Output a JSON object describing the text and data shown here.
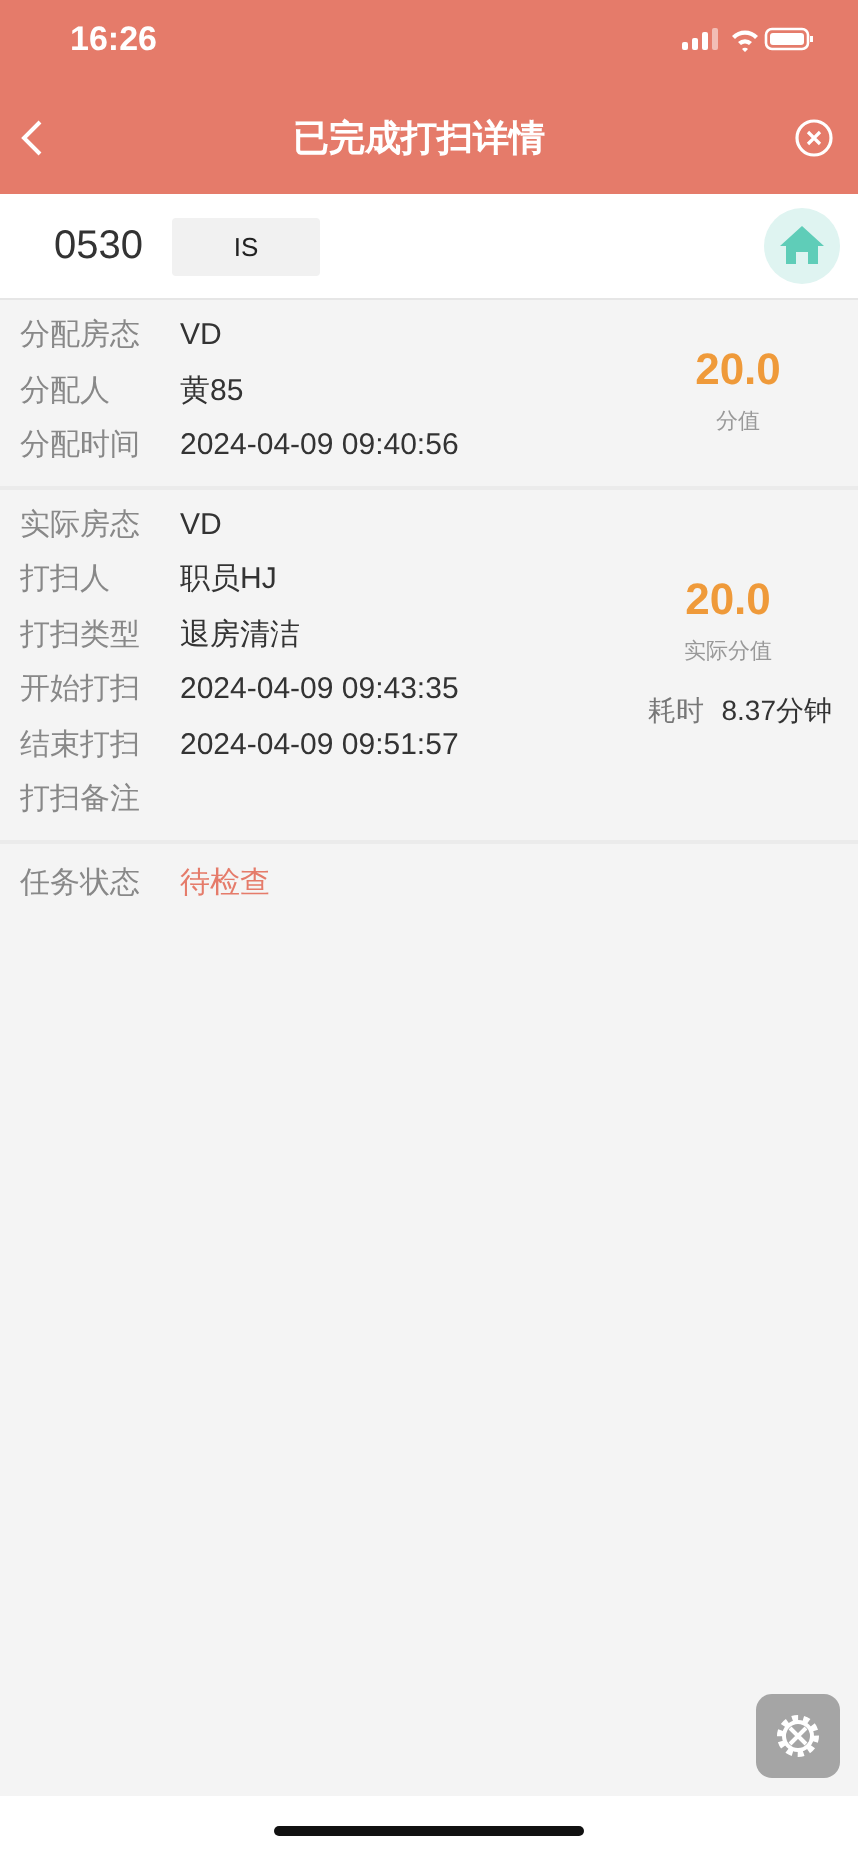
{
  "status_bar": {
    "time": "16:26"
  },
  "nav": {
    "title": "已完成打扫详情"
  },
  "room": {
    "number": "0530",
    "status": "IS"
  },
  "assigned": {
    "rows": [
      {
        "label": "分配房态",
        "value": "VD"
      },
      {
        "label": "分配人",
        "value": "黄85"
      },
      {
        "label": "分配时间",
        "value": "2024-04-09 09:40:56"
      }
    ],
    "score": "20.0",
    "score_label": "分值"
  },
  "actual": {
    "rows": [
      {
        "label": "实际房态",
        "value": "VD"
      },
      {
        "label": "打扫人",
        "value": "职员HJ"
      },
      {
        "label": "打扫类型",
        "value": "退房清洁"
      },
      {
        "label": "开始打扫",
        "value": "2024-04-09 09:43:35"
      },
      {
        "label": "结束打扫",
        "value": "2024-04-09 09:51:57"
      },
      {
        "label": "打扫备注"
      }
    ],
    "score": "20.0",
    "score_label": "实际分值",
    "duration_label": "耗时",
    "duration": "8.37分钟"
  },
  "task_status": {
    "label": "任务状态",
    "value": "待检查"
  }
}
